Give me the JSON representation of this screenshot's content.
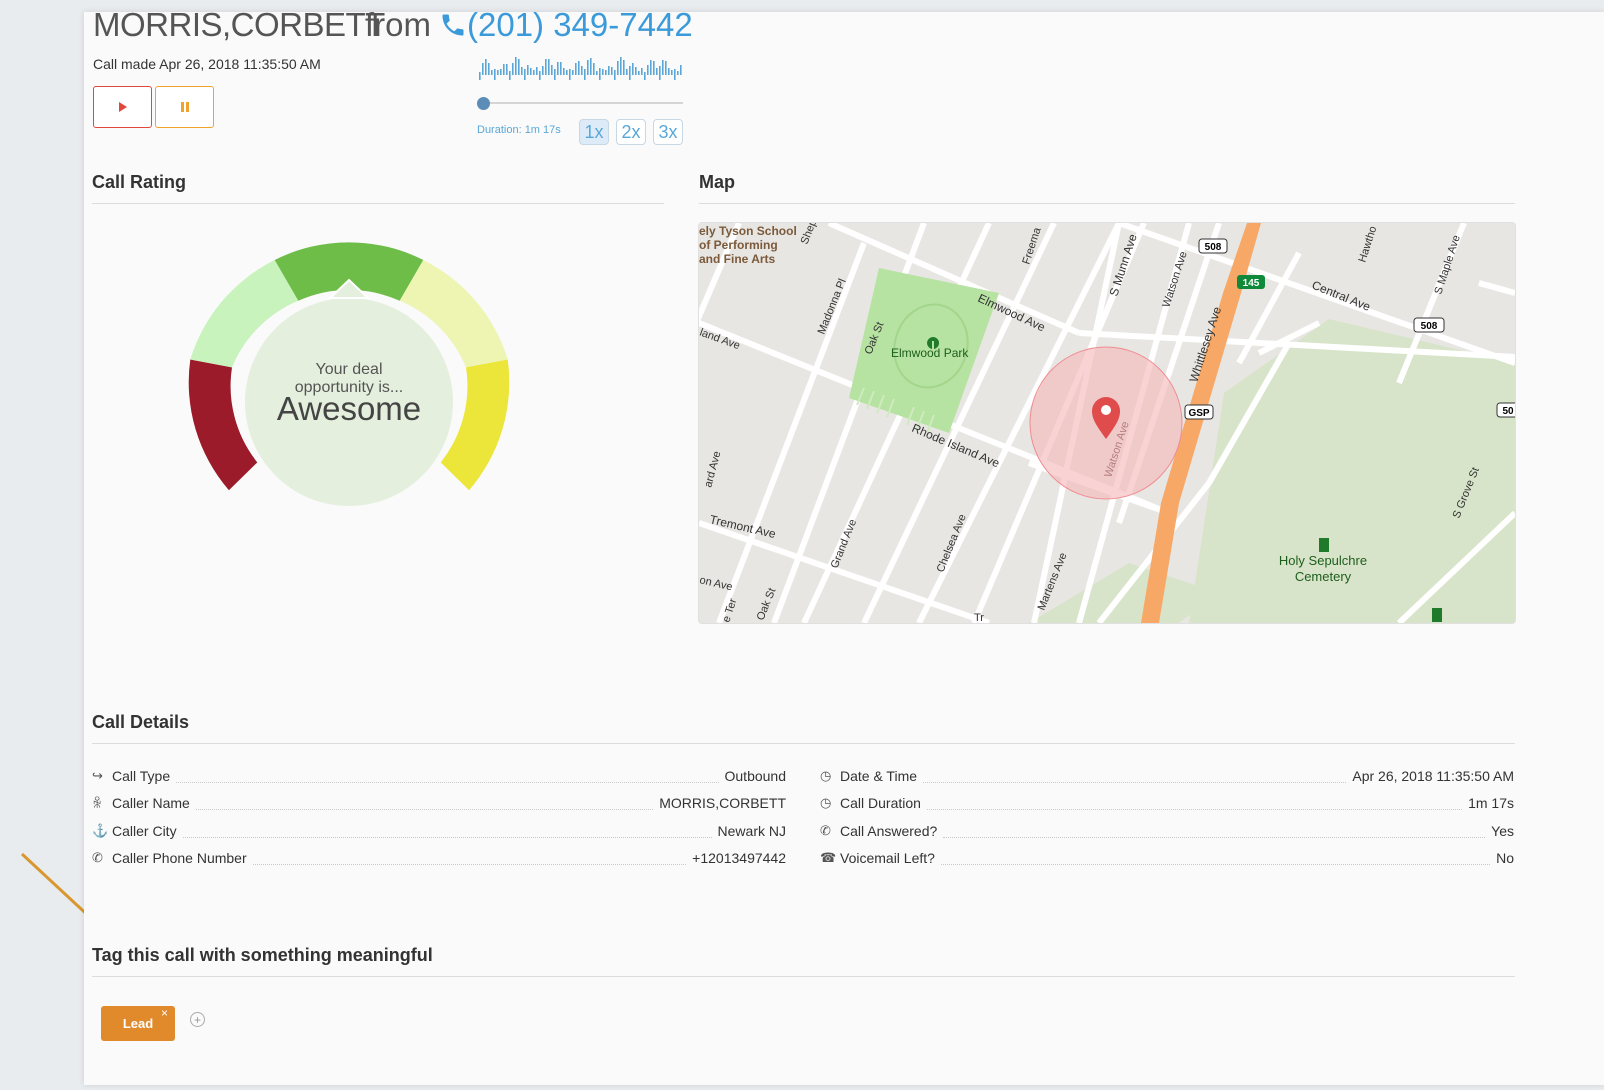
{
  "header": {
    "caller_name": "MORRIS,CORBETT",
    "from_label": "from",
    "phone": "(201) 349-7442",
    "call_made": "Call made Apr 26, 2018 11:35:50 AM"
  },
  "player": {
    "duration": "Duration: 1m 17s",
    "progress": 0,
    "speeds": [
      "1x",
      "2x",
      "3x"
    ],
    "active_speed": "1x"
  },
  "call_rating": {
    "title": "Call Rating",
    "gauge_line1": "Your deal",
    "gauge_line2": "opportunity is...",
    "gauge_value": "Awesome",
    "segments": [
      "#9b1b2a",
      "#c9f3bd",
      "#6dbd48",
      "#eef5b3",
      "#ece53a"
    ],
    "selected_segment": 2
  },
  "map": {
    "title": "Map",
    "labels": {
      "school1": "ely Tyson School",
      "school2": "of Performing",
      "school3": "and Fine Arts",
      "elmwood_park": "Elmwood Park",
      "elmwood_ave": "Elmwood Ave",
      "rhode_island_ave": "Rhode Island Ave",
      "tremont_ave": "Tremont Ave",
      "central_ave": "Central Ave",
      "s_munn_ave": "S Munn Ave",
      "whittlesey_ave": "Whittlesey Ave",
      "watson_ave": "Watson Ave",
      "watson_ave2": "Watson Ave",
      "madonna_pl": "Madonna Pl",
      "oak_st": "Oak St",
      "oak_st2": "Oak St",
      "grand_ave": "Grand Ave",
      "chelsea_ave": "Chelsea Ave",
      "martens_ave": "Martens Ave",
      "s_grove_st": "S Grove St",
      "s_maple_ave": "S Maple Ave",
      "cemetery1": "Holy Sepulchre",
      "cemetery2": "Cemetery",
      "freeman": "Freema",
      "hawth": "Hawtho",
      "shep": "Shep",
      "land_ave": "land Ave",
      "ard_ave": "ard Ave",
      "on_ave": "on Ave",
      "e_ter": "e Ter",
      "tr": "Tr",
      "shield_508a": "508",
      "shield_508b": "508",
      "shield_145": "145",
      "shield_gsp": "GSP",
      "shield_50": "50"
    }
  },
  "call_details": {
    "title": "Call Details",
    "left": [
      {
        "icon": "share-icon",
        "glyph": "↪",
        "label": "Call Type",
        "value": "Outbound"
      },
      {
        "icon": "user-icon",
        "glyph": "ꆜ",
        "label": "Caller Name",
        "value": "MORRIS,CORBETT"
      },
      {
        "icon": "location-icon",
        "glyph": "⚓",
        "label": "Caller City",
        "value": "Newark NJ"
      },
      {
        "icon": "phone-icon",
        "glyph": "✆",
        "label": "Caller Phone Number",
        "value": "+12013497442"
      }
    ],
    "right": [
      {
        "icon": "clock-icon",
        "glyph": "◷",
        "label": "Date & Time",
        "value": "Apr 26, 2018 11:35:50 AM"
      },
      {
        "icon": "clock-icon",
        "glyph": "◷",
        "label": "Call Duration",
        "value": "1m 17s"
      },
      {
        "icon": "phone-icon",
        "glyph": "✆",
        "label": "Call Answered?",
        "value": "Yes"
      },
      {
        "icon": "voicemail-icon",
        "glyph": "☎",
        "label": "Voicemail Left?",
        "value": "No"
      }
    ]
  },
  "tags": {
    "title": "Tag this call with something meaningful",
    "items": [
      {
        "label": "Lead"
      }
    ],
    "remove_glyph": "×",
    "add_glyph": "+"
  },
  "colors": {
    "accent_blue": "#3b9ad9",
    "play_red": "#e2473b",
    "pause_orange": "#f0a32c",
    "tag_orange": "#e08a2c",
    "arrow_orange": "#d9982f"
  }
}
